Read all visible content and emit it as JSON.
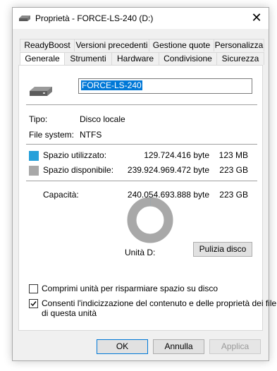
{
  "window": {
    "title": "Proprietà - FORCE-LS-240 (D:)",
    "close_glyph": "✕"
  },
  "tabs": {
    "row_top": [
      {
        "label": "ReadyBoost"
      },
      {
        "label": "Versioni precedenti"
      },
      {
        "label": "Gestione quote"
      },
      {
        "label": "Personalizza"
      }
    ],
    "row_bottom": [
      {
        "label": "Generale",
        "active": true
      },
      {
        "label": "Strumenti"
      },
      {
        "label": "Hardware"
      },
      {
        "label": "Condivisione"
      },
      {
        "label": "Sicurezza"
      }
    ]
  },
  "general": {
    "drive_name": "FORCE-LS-240",
    "type_label": "Tipo:",
    "type_value": "Disco locale",
    "fs_label": "File system:",
    "fs_value": "NTFS",
    "used": {
      "label": "Spazio utilizzato:",
      "bytes": "129.724.416 byte",
      "size": "123 MB",
      "color": "#26a0da"
    },
    "free": {
      "label": "Spazio disponibile:",
      "bytes": "239.924.969.472 byte",
      "size": "223 GB",
      "color": "#a8a8a8"
    },
    "capacity": {
      "label": "Capacità:",
      "bytes": "240.054.693.888 byte",
      "size": "223 GB"
    },
    "used_fraction": 0.0005,
    "drive_label": "Unità D:",
    "cleanup_button": "Pulizia disco",
    "compress_label": "Comprimi unità per risparmiare spazio su disco",
    "compress_checked": false,
    "index_label_line1": "Consenti l'indicizzazione del contenuto e delle proprietà dei file",
    "index_label_line2": "di questa unità",
    "index_checked": true
  },
  "buttons": {
    "ok": "OK",
    "cancel": "Annulla",
    "apply": "Applica"
  },
  "colors": {
    "accent": "#0078d7",
    "used": "#26a0da",
    "free": "#a8a8a8"
  }
}
